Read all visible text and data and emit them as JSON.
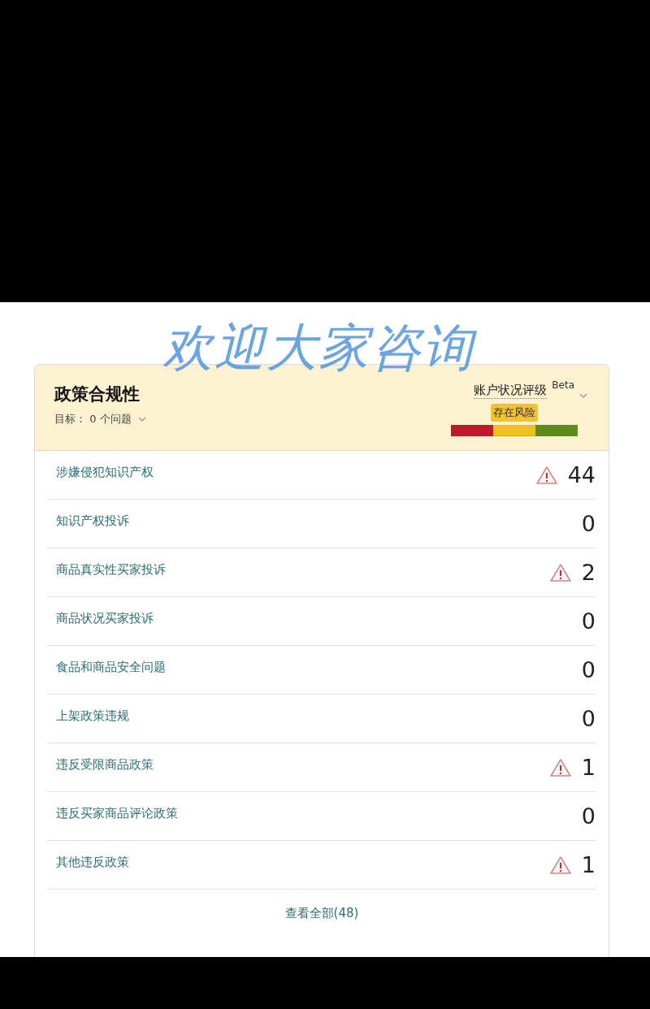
{
  "overlay_caption": "欢迎大家咨询",
  "panel": {
    "title": "政策合规性",
    "target": "目标： 0 个问题",
    "rating": {
      "label": "账户状况评级",
      "badge": "Beta",
      "status": "存在风险",
      "segments": [
        {
          "color": "#c2172b",
          "selected": false
        },
        {
          "color": "#f2c21c",
          "selected": true
        },
        {
          "color": "#5b8c1d",
          "selected": false
        }
      ]
    },
    "rows": [
      {
        "label": "涉嫌侵犯知识产权",
        "count": "44",
        "warning": true
      },
      {
        "label": "知识产权投诉",
        "count": "0",
        "warning": false
      },
      {
        "label": "商品真实性买家投诉",
        "count": "2",
        "warning": true
      },
      {
        "label": "商品状况买家投诉",
        "count": "0",
        "warning": false
      },
      {
        "label": "食品和商品安全问题",
        "count": "0",
        "warning": false
      },
      {
        "label": "上架政策违规",
        "count": "0",
        "warning": false
      },
      {
        "label": "违反受限商品政策",
        "count": "1",
        "warning": true
      },
      {
        "label": "违反买家商品评论政策",
        "count": "0",
        "warning": false
      },
      {
        "label": "其他违反政策",
        "count": "1",
        "warning": true
      }
    ],
    "view_all": "查看全部(48)"
  }
}
